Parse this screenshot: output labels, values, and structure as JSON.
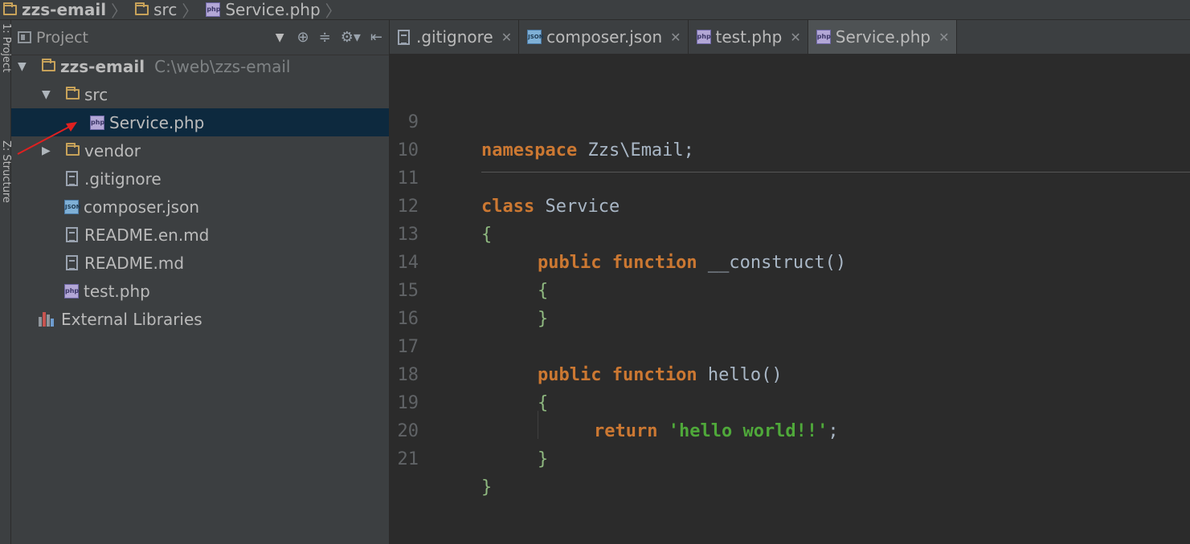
{
  "breadcrumb": {
    "items": [
      {
        "label": "zzs-email",
        "icon": "folder-icon"
      },
      {
        "label": "src",
        "icon": "folder-icon"
      },
      {
        "label": "Service.php",
        "icon": "php-icon"
      }
    ]
  },
  "tool_strip": {
    "project_tab": "1: Project",
    "structure_tab": "Z: Structure"
  },
  "project_panel": {
    "title": "Project",
    "tree": [
      {
        "label": "zzs-email",
        "path": "C:\\web\\zzs-email"
      },
      {
        "label": "src"
      },
      {
        "label": "Service.php"
      },
      {
        "label": "vendor"
      },
      {
        "label": ".gitignore"
      },
      {
        "label": "composer.json"
      },
      {
        "label": "README.en.md"
      },
      {
        "label": "README.md"
      },
      {
        "label": "test.php"
      },
      {
        "label": "External Libraries"
      }
    ]
  },
  "editor": {
    "tabs": [
      {
        "label": ".gitignore",
        "icon": "text-icon"
      },
      {
        "label": "composer.json",
        "icon": "json-icon"
      },
      {
        "label": "test.php",
        "icon": "php-icon"
      },
      {
        "label": "Service.php",
        "icon": "php-icon",
        "active": true
      }
    ],
    "line_numbers": [
      "9",
      "10",
      "11",
      "12",
      "13",
      "14",
      "15",
      "16",
      "17",
      "18",
      "19",
      "20",
      "21"
    ],
    "code": {
      "l9_kw": "namespace",
      "l9_ns": " Zzs\\Email;",
      "l11_kw": "class",
      "l11_name": " Service",
      "open_brace": "{",
      "close_brace": "}",
      "l13_kw": "public function",
      "l13_fn": " __construct()",
      "l17_kw": "public function",
      "l17_fn": " hello()",
      "l19_kw": "return",
      "l19_str": "'hello world!!'",
      "l19_semi": ";"
    }
  },
  "colors": {
    "keyword": "#cc7832",
    "string": "#4fa83a",
    "selection": "#0d293e",
    "annotation_arrow": "#e02020"
  }
}
